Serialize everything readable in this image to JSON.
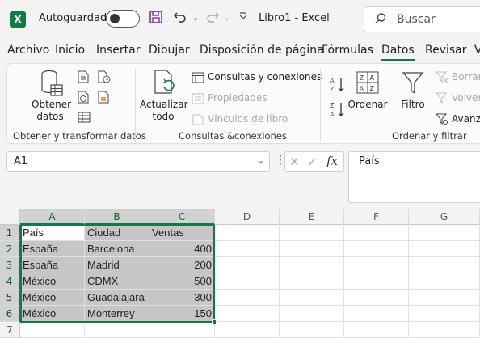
{
  "titlebar": {
    "app_icon": "excel-logo",
    "autosave_label": "Autoguardado",
    "autosave_state": "off",
    "doc_title": "Libro1  -  Excel",
    "search_placeholder": "Buscar",
    "icons": [
      "save-icon",
      "undo-icon",
      "redo-icon",
      "customize-chevron-icon",
      "search-icon"
    ]
  },
  "menu": {
    "items": [
      "Archivo",
      "Inicio",
      "Insertar",
      "Dibujar",
      "Disposición de página",
      "Fórmulas",
      "Datos",
      "Revisar",
      "V"
    ],
    "active": "Datos"
  },
  "ribbon": {
    "get_data": {
      "label1": "Obtener",
      "label2": "datos",
      "group_label": "Obtener y transformar datos"
    },
    "refresh": {
      "label1": "Actualizar",
      "label2": "todo"
    },
    "queries": [
      "Consultas y conexiones",
      "Propiedades",
      "Vínculos de libro"
    ],
    "queries_group_label": "Consultas &conexiones",
    "sort_label": "Ordenar",
    "filter_label": "Filtro",
    "filter_side": [
      "Borrar",
      "Volver",
      "Avanz"
    ],
    "sort_group_label": "Ordenar y filtrar",
    "accent_color": "#107c41"
  },
  "formula_bar": {
    "name_box": "A1",
    "formula": "País",
    "fx_label": "fx"
  },
  "sheet": {
    "columns": [
      "A",
      "B",
      "C",
      "D",
      "E",
      "F",
      "G"
    ],
    "rows": [
      "1",
      "2",
      "3",
      "4",
      "5",
      "6",
      "7"
    ],
    "data": [
      [
        "País",
        "Ciudad",
        "Ventas"
      ],
      [
        "España",
        "Barcelona",
        "400"
      ],
      [
        "España",
        "Madrid",
        "200"
      ],
      [
        "México",
        "CDMX",
        "500"
      ],
      [
        "México",
        "Guadalajara",
        "300"
      ],
      [
        "México",
        "Monterrey",
        "150"
      ]
    ],
    "selected_range": "A1:C6",
    "active_cell": "A1"
  }
}
